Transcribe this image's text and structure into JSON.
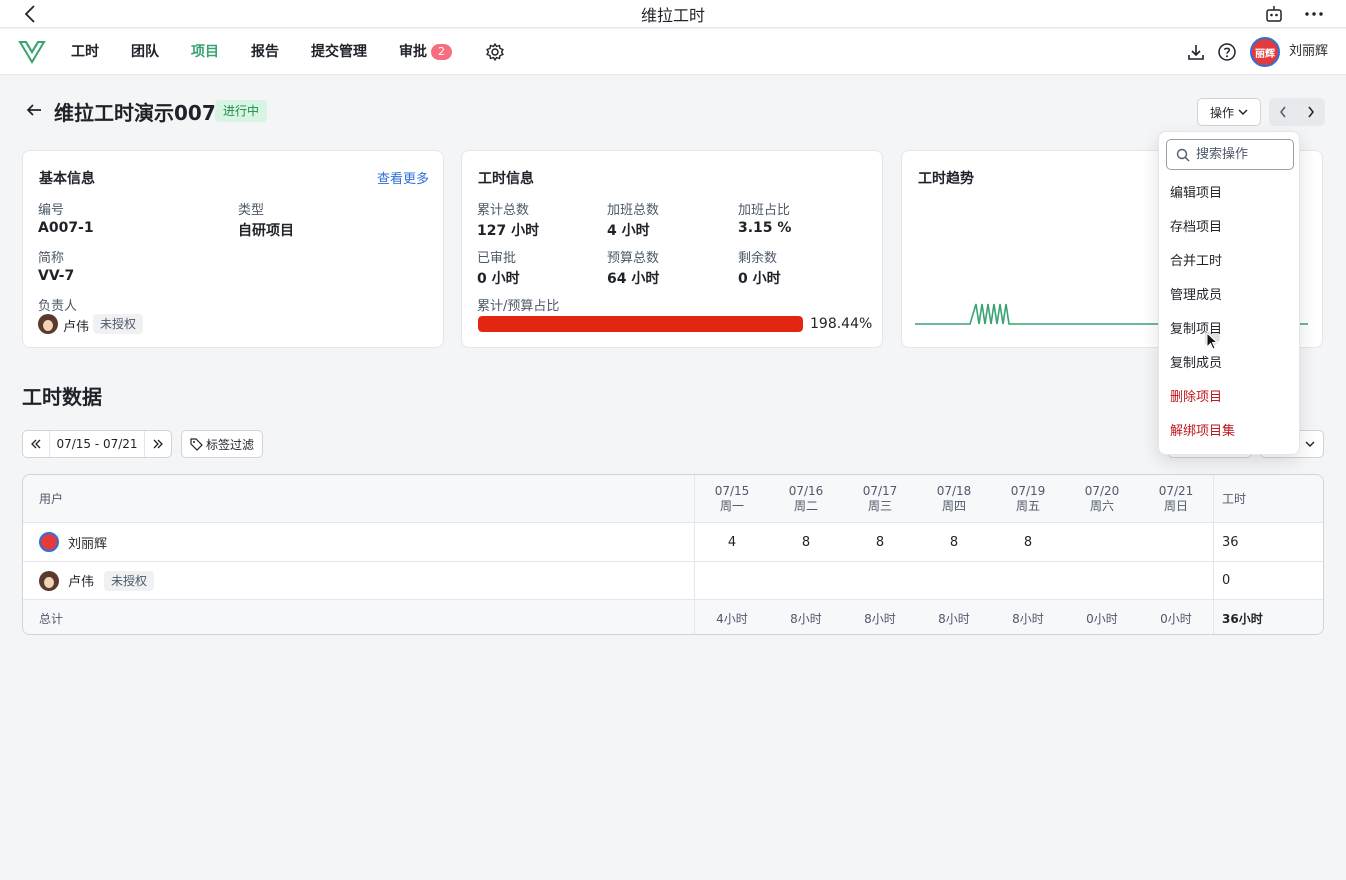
{
  "window": {
    "title": "维拉工时"
  },
  "nav": {
    "items": [
      {
        "label": "工时"
      },
      {
        "label": "团队"
      },
      {
        "label": "项目"
      },
      {
        "label": "报告"
      },
      {
        "label": "提交管理"
      },
      {
        "label": "审批",
        "badge": "2"
      }
    ],
    "user_name": "刘丽辉",
    "avatar_text": "丽辉"
  },
  "header": {
    "title": "维拉工时演示007",
    "status": "进行中",
    "ops_label": "操作"
  },
  "basic_info": {
    "title": "基本信息",
    "more": "查看更多",
    "code_label": "编号",
    "code": "A007-1",
    "type_label": "类型",
    "type": "自研项目",
    "abbr_label": "简称",
    "abbr": "VV-7",
    "owner_label": "负责人",
    "owner": "卢伟",
    "owner_tag": "未授权"
  },
  "hours_info": {
    "title": "工时信息",
    "total_label": "累计总数",
    "total": "127 小时",
    "ot_label": "加班总数",
    "ot": "4 小时",
    "ot_ratio_label": "加班占比",
    "ot_ratio": "3.15 %",
    "approved_label": "已审批",
    "approved": "0 小时",
    "budget_label": "预算总数",
    "budget": "64 小时",
    "remain_label": "剩余数",
    "remain": "0 小时",
    "ratio_label": "累计/预算占比",
    "ratio": "198.44%",
    "ratio_value": 198.44
  },
  "trend": {
    "title": "工时趋势"
  },
  "section": {
    "title": "工时数据",
    "date_range": "07/15 - 07/21",
    "tag_filter": "标签过滤"
  },
  "table": {
    "user_header": "用户",
    "hours_header": "工时",
    "days": [
      {
        "date": "07/15",
        "weekday": "周一"
      },
      {
        "date": "07/16",
        "weekday": "周二"
      },
      {
        "date": "07/17",
        "weekday": "周三"
      },
      {
        "date": "07/18",
        "weekday": "周四"
      },
      {
        "date": "07/19",
        "weekday": "周五"
      },
      {
        "date": "07/20",
        "weekday": "周六"
      },
      {
        "date": "07/21",
        "weekday": "周日"
      }
    ],
    "rows": [
      {
        "user": "刘丽辉",
        "tag": "",
        "values": [
          "4",
          "8",
          "8",
          "8",
          "8",
          "",
          ""
        ],
        "total": "36"
      },
      {
        "user": "卢伟",
        "tag": "未授权",
        "values": [
          "",
          "",
          "",
          "",
          "",
          "",
          ""
        ],
        "total": "0"
      }
    ],
    "total_row": {
      "label": "总计",
      "values": [
        "4小时",
        "8小时",
        "8小时",
        "8小时",
        "8小时",
        "0小时",
        "0小时"
      ],
      "total": "36小时"
    }
  },
  "dropdown": {
    "search_placeholder": "搜索操作",
    "items": [
      {
        "label": "编辑项目"
      },
      {
        "label": "存档项目"
      },
      {
        "label": "合并工时"
      },
      {
        "label": "管理成员"
      },
      {
        "label": "复制项目"
      },
      {
        "label": "复制成员"
      },
      {
        "label": "删除项目"
      },
      {
        "label": "解绑项目集"
      }
    ]
  },
  "colors": {
    "accent": "#3ba272",
    "danger": "#c0161d",
    "progress": "#e3260f",
    "badge": "#f76f7f"
  }
}
